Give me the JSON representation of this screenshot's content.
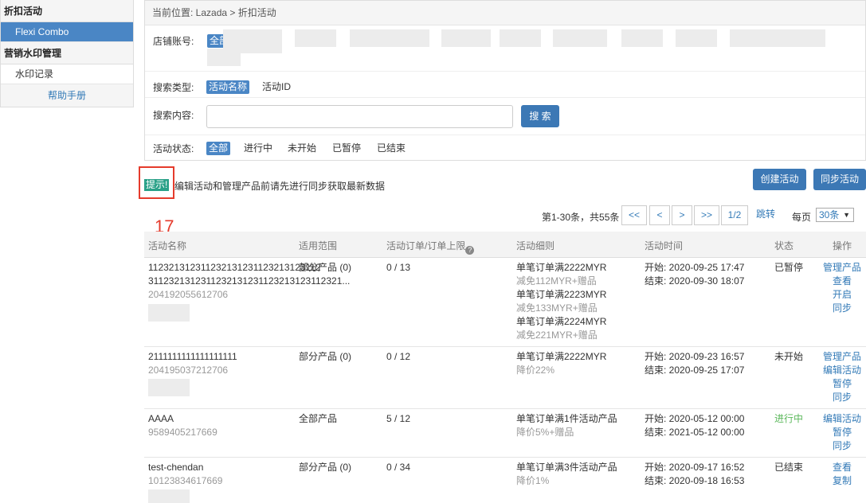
{
  "sidebar": {
    "sections": [
      {
        "title": "折扣活动",
        "items": [
          {
            "label": "Flexi Combo",
            "active": true
          }
        ]
      },
      {
        "title": "营销水印管理",
        "items": [
          {
            "label": "水印记录",
            "active": false
          }
        ]
      }
    ],
    "help": "帮助手册"
  },
  "breadcrumb": "当前位置:  Lazada > 折扣活动",
  "filters": {
    "store_label": "店铺账号:",
    "store_all": "全部",
    "type_label": "搜索类型:",
    "types": [
      "活动名称",
      "活动ID"
    ],
    "content_label": "搜索内容:",
    "search_value": "",
    "search_button": "搜 索",
    "status_label": "活动状态:",
    "statuses": [
      "全部",
      "进行中",
      "未开始",
      "已暂停",
      "已结束"
    ]
  },
  "hint": {
    "tag": "提示!",
    "text": "编辑活动和管理产品前请先进行同步获取最新数据",
    "annotation": "17"
  },
  "actions": {
    "create": "创建活动",
    "sync": "同步活动"
  },
  "pagination": {
    "info": "第1-30条，共55条",
    "buttons": [
      "<<",
      "<",
      ">",
      ">>",
      "1/2",
      "跳转"
    ],
    "per_page_label": "每页",
    "per_page_value": "30条"
  },
  "table": {
    "headers": [
      "活动名称",
      "适用范围",
      "活动订单/订单上限",
      "活动细则",
      "活动时间",
      "状态",
      "操作"
    ],
    "rows": [
      {
        "name_line1": "112321312311232131231123213123112",
        "name_line2": "3112321312311232131231123213123112321...",
        "id": "204192055612706",
        "scope": "部分产品 (0)",
        "orders": "0 / 13",
        "rules": [
          {
            "main": "单笔订单满2222MYR",
            "sub": "减免112MYR+赠品"
          },
          {
            "main": "单笔订单满2223MYR",
            "sub": "减免133MYR+赠品"
          },
          {
            "main": "单笔订单满2224MYR",
            "sub": "减免221MYR+赠品"
          }
        ],
        "start": "开始: 2020-09-25 17:47",
        "end": "结束: 2020-09-30 18:07",
        "status": "已暂停",
        "ops": [
          "管理产品",
          "查看",
          "开启",
          "同步"
        ]
      },
      {
        "name_line1": "2111111111111111111",
        "name_line2": "",
        "id": "204195037212706",
        "scope": "部分产品 (0)",
        "orders": "0 / 12",
        "rules": [
          {
            "main": "单笔订单满2222MYR",
            "sub": "降价22%"
          }
        ],
        "start": "开始: 2020-09-23 16:57",
        "end": "结束: 2020-09-25 17:07",
        "status": "未开始",
        "ops": [
          "管理产品",
          "编辑活动",
          "暂停",
          "同步"
        ]
      },
      {
        "name_line1": "AAAA",
        "name_line2": "",
        "id": "9589405217669",
        "scope": "全部产品",
        "orders": "5 / 12",
        "rules": [
          {
            "main": "单笔订单满1件活动产品",
            "sub": "降价5%+赠品"
          }
        ],
        "start": "开始: 2020-05-12 00:00",
        "end": "结束: 2021-05-12 00:00",
        "status": "进行中",
        "ops": [
          "编辑活动",
          "暂停",
          "同步"
        ]
      },
      {
        "name_line1": "test-chendan",
        "name_line2": "",
        "id": "10123834617669",
        "scope": "部分产品 (0)",
        "orders": "0 / 34",
        "rules": [
          {
            "main": "单笔订单满3件活动产品",
            "sub": "降价1%"
          }
        ],
        "start": "开始: 2020-09-17 16:52",
        "end": "结束: 2020-09-18 16:53",
        "status": "已结束",
        "ops": [
          "查看",
          "复制"
        ]
      }
    ]
  },
  "colors": {
    "primary": "#3c78b5",
    "hint": "#2aa188",
    "annotation": "#e53b2c",
    "active_status": "#5cb85c"
  }
}
